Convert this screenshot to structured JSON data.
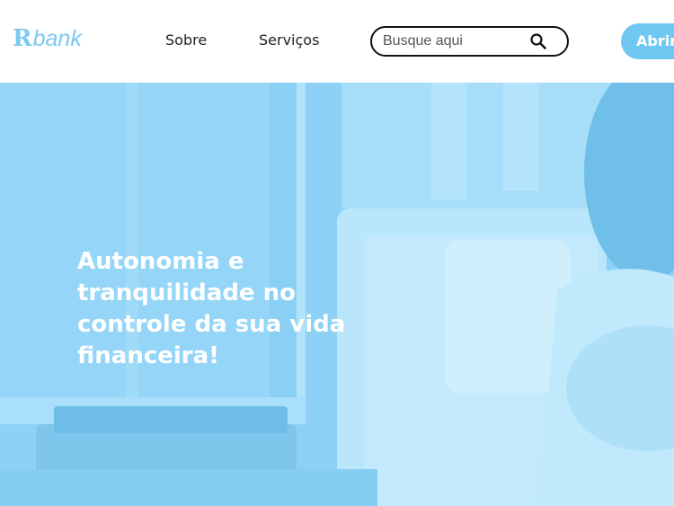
{
  "brand": {
    "logo_mark": "R",
    "logo_text": "bank",
    "color": "#7cc8ef"
  },
  "nav": {
    "items": [
      {
        "label": "Sobre"
      },
      {
        "label": "Serviços"
      }
    ]
  },
  "search": {
    "placeholder": "Busque aqui",
    "value": "",
    "icon": "search-icon"
  },
  "cta": {
    "label": "Abrir",
    "color": "#6ec8f2"
  },
  "hero": {
    "title": "Autonomia e tranquilidade no controle da sua vida financeira!",
    "overlay_color": "#8dd2f6"
  }
}
